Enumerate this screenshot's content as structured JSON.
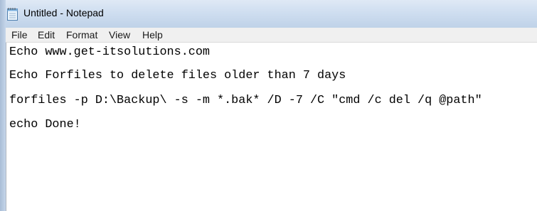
{
  "window": {
    "title": "Untitled - Notepad",
    "icon": "notepad-icon"
  },
  "menu": [
    {
      "label": "File"
    },
    {
      "label": "Edit"
    },
    {
      "label": "Format"
    },
    {
      "label": "View"
    },
    {
      "label": "Help"
    }
  ],
  "editor": {
    "lines": [
      "Echo www.get-itsolutions.com",
      "Echo Forfiles to delete files older than 7 days",
      "forfiles -p D:\\Backup\\ -s -m *.bak* /D -7 /C \"cmd /c del /q @path\"",
      "echo Done!"
    ]
  },
  "colors": {
    "titlebar": "#cfdef0",
    "menubar": "#f0f0f0",
    "editor_bg": "#ffffff",
    "text": "#000000"
  }
}
